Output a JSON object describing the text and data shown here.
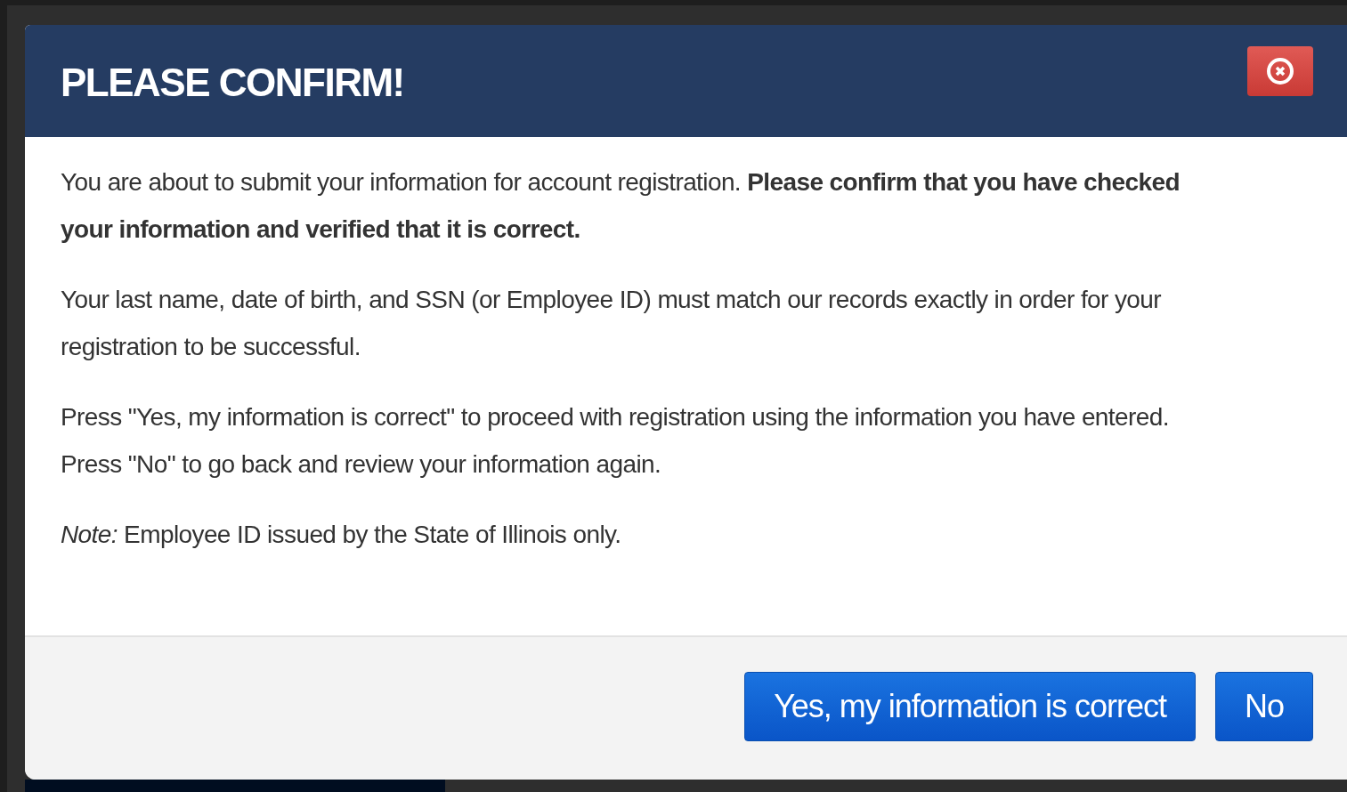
{
  "dialog": {
    "title": "PLEASE CONFIRM!",
    "paragraphs": [
      "You are about to submit your information for account registration. **Please confirm that you have checked your information and verified that it is correct.**",
      "Your last name, date of birth, and SSN (or Employee ID) must match our records exactly in order for your registration to be successful.",
      "Press \"Yes, my information is correct\" to proceed with registration using the information you have entered. Press \"No\" to go back and review your information again.",
      "*Note:* Employee ID issued by the State of Illinois only."
    ],
    "buttons": [
      {
        "label": "Yes, my information is correct",
        "kind": "primary"
      },
      {
        "label": "No",
        "kind": "primary"
      }
    ]
  }
}
